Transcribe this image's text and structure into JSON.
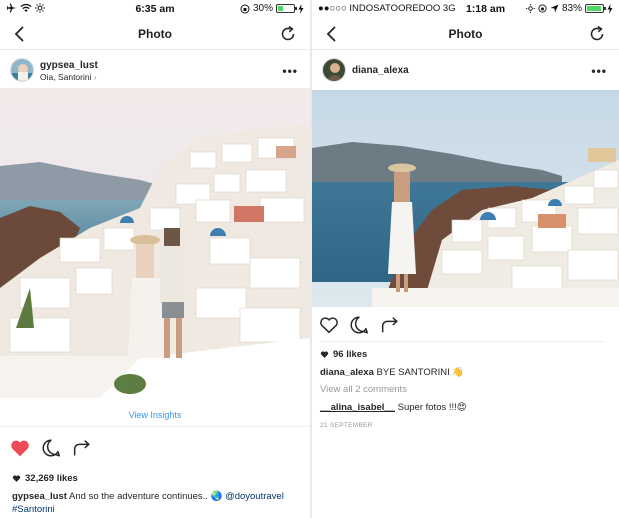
{
  "left": {
    "status": {
      "time": "6:35 am",
      "battery": "30%",
      "battery_level": 0.3
    },
    "nav": {
      "title": "Photo"
    },
    "post": {
      "username": "gypsea_lust",
      "location": "Oia, Santorini",
      "location_chevron": "›",
      "more": "•••",
      "insights": "View Insights",
      "likes": "32,269 likes",
      "caption_user": "gypsea_lust",
      "caption_text": "And so the adventure continues.. 🌏",
      "caption_mention": "@doyoutravel",
      "caption_hashtag": "#Santorini"
    }
  },
  "right": {
    "status": {
      "carrier": "●●○○○ INDOSATOOREDOO  3G",
      "time": "1:18 am",
      "battery": "83%",
      "battery_level": 0.83
    },
    "nav": {
      "title": "Photo"
    },
    "post": {
      "username": "diana_alexa",
      "more": "•••",
      "likes": "96 likes",
      "caption_user": "diana_alexa",
      "caption_text": "BYE SANTORINI 👋",
      "view_comments": "View all 2 comments",
      "comment_user": "__alina_isabel__",
      "comment_text": "Super fotos !!!😍",
      "date": "21 SEPTEMBER"
    }
  },
  "colors": {
    "like_red": "#ed4956",
    "link_blue": "#003569",
    "insights_blue": "#3897f0",
    "muted": "#999999"
  }
}
